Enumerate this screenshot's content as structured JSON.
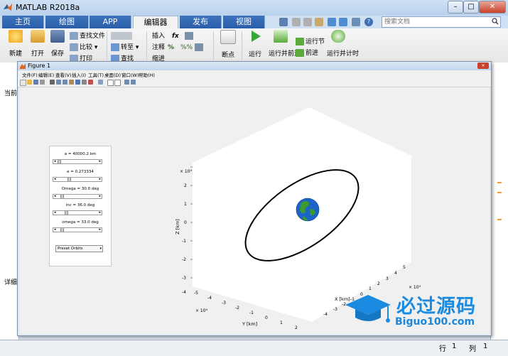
{
  "app": {
    "title": "MATLAB R2018a"
  },
  "tabs": [
    {
      "label": "主页"
    },
    {
      "label": "绘图"
    },
    {
      "label": "APP"
    },
    {
      "label": "编辑器"
    },
    {
      "label": "发布"
    },
    {
      "label": "视图"
    }
  ],
  "search": {
    "placeholder": "搜索文档"
  },
  "ribbon": {
    "new": "新建",
    "open": "打开",
    "save": "保存",
    "find_files": "查找文件",
    "compare": "比较",
    "print": "打印",
    "goto": "转至",
    "find": "查找",
    "insert": "插入",
    "comment": "注释",
    "indent": "缩进",
    "fx": "fx",
    "breakpoints": "断点",
    "run": "运行",
    "run_advance": "运行并前进",
    "run_section": "运行节",
    "advance": "前进",
    "run_and_time": "运行并计时"
  },
  "left_labels": {
    "current": "当前",
    "details": "详细"
  },
  "figure": {
    "title": "Figure 1",
    "menu": [
      "文件(F)",
      "编辑(E)",
      "查看(V)",
      "插入(I)",
      "工具(T)",
      "桌面(D)",
      "窗口(W)",
      "帮助(H)"
    ]
  },
  "panel": {
    "sliders": [
      {
        "label": "a = 40000.2 km",
        "value": 0.02
      },
      {
        "label": "e = 0.273334",
        "value": 0.27
      },
      {
        "label": "Omega = 30.0 deg",
        "value": 0.08
      },
      {
        "label": "inc = 36.0 deg",
        "value": 0.2
      },
      {
        "label": "omega = 33.0 deg",
        "value": 0.09
      }
    ],
    "preset": "Preset Orbits"
  },
  "plot": {
    "z_exponent": "× 10⁴",
    "x_exponent": "× 10⁴",
    "y_exponent": "× 10⁴",
    "zlabel": "Z [km]",
    "xlabel": "X [km]",
    "ylabel": "Y [km]",
    "z_ticks": [
      "2",
      "1",
      "0",
      "-1",
      "-2",
      "-3",
      "-4"
    ],
    "x_ticks": [
      "5",
      "4",
      "3",
      "2",
      "1",
      "0",
      "-1",
      "-2",
      "-3",
      "-4"
    ],
    "y_ticks": [
      "-5",
      "-4",
      "-3",
      "-2",
      "-1",
      "0",
      "1",
      "2"
    ]
  },
  "status": {
    "row_label": "行",
    "row": "1",
    "col_label": "列",
    "col": "1"
  },
  "watermark": {
    "title": "必过源码",
    "url": "Biguo100.com"
  },
  "colors": {
    "accent": "#2a5ea8",
    "earth_ocean": "#1c64c8",
    "earth_land": "#3c9b2a",
    "orbit": "#000000",
    "watermark": "#1b8be1"
  }
}
